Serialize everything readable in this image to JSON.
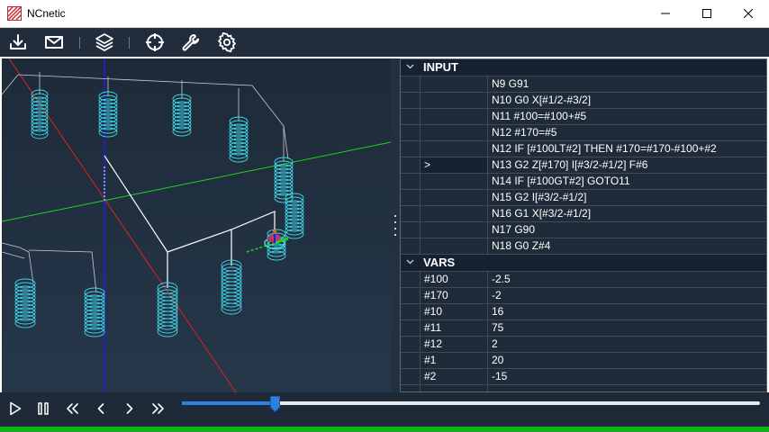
{
  "window": {
    "title": "NCnetic"
  },
  "toolbar": {
    "icons": [
      "download-icon",
      "mail-icon",
      "layers-icon",
      "crosshair-icon",
      "wrench-icon",
      "gear-icon"
    ]
  },
  "input": {
    "title": "INPUT",
    "lines": [
      {
        "marker": "",
        "code": "N9 G91"
      },
      {
        "marker": "",
        "code": "N10 G0 X[#1/2-#3/2]"
      },
      {
        "marker": "",
        "code": "N11 #100=#100+#5"
      },
      {
        "marker": "",
        "code": "N12 #170=#5"
      },
      {
        "marker": "",
        "code": "N12 IF [#100LT#2] THEN #170=#170-#100+#2"
      },
      {
        "marker": ">",
        "code": "N13 G2 Z[#170] I[#3/2-#1/2] F#6"
      },
      {
        "marker": "",
        "code": "N14 IF [#100GT#2] GOTO11"
      },
      {
        "marker": "",
        "code": "N15 G2 I[#3/2-#1/2]"
      },
      {
        "marker": "",
        "code": "N16 G1 X[#3/2-#1/2]"
      },
      {
        "marker": "",
        "code": "N17 G90"
      },
      {
        "marker": "",
        "code": "N18 G0 Z#4"
      }
    ]
  },
  "vars": {
    "title": "VARS",
    "rows": [
      {
        "name": "#100",
        "value": "-2.5"
      },
      {
        "name": "#170",
        "value": "-2"
      },
      {
        "name": "#10",
        "value": "16"
      },
      {
        "name": "#11",
        "value": "75"
      },
      {
        "name": "#12",
        "value": "2"
      },
      {
        "name": "#1",
        "value": "20"
      },
      {
        "name": "#2",
        "value": "-15"
      }
    ]
  },
  "playback": {
    "controls": [
      "play-icon",
      "pause-icon",
      "rewind-icon",
      "step-back-icon",
      "step-forward-icon",
      "fast-forward-icon"
    ],
    "slider_fraction": 0.16,
    "progress_fraction": 1.0
  },
  "colors": {
    "accent": "#2f7fe0",
    "progress": "#12b01a",
    "toolpath": "#3fd6e6",
    "axis_x": "#e02020",
    "axis_y": "#1ed41e",
    "axis_z": "#1a22d8"
  }
}
